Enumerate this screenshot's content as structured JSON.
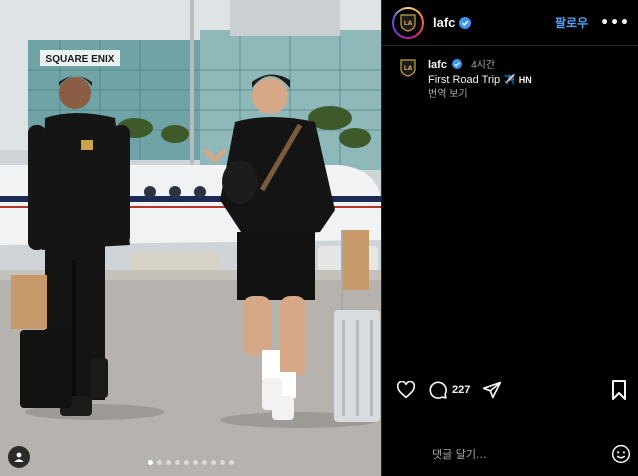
{
  "photo": {
    "sign_text": "SQUARE ENIX",
    "carousel": {
      "total": 10,
      "active": 0
    }
  },
  "post": {
    "username": "lafc",
    "follow_label": "팔로우",
    "more_label": "•••",
    "caption": {
      "username": "lafc",
      "time": "4시간",
      "text": "First Road Trip",
      "tag": "HN",
      "translate_label": "번역 보기"
    },
    "comments_count": "227",
    "comment_placeholder": "댓글 달기..."
  },
  "colors": {
    "follow": "#4fa3f7",
    "background": "#000000",
    "muted": "#a8a8a8"
  },
  "icons": [
    "user-tag-icon",
    "lafc-crest-icon",
    "verified-icon",
    "heart-icon",
    "comment-icon",
    "share-icon",
    "bookmark-icon",
    "emoji-icon",
    "airplane-icon"
  ]
}
